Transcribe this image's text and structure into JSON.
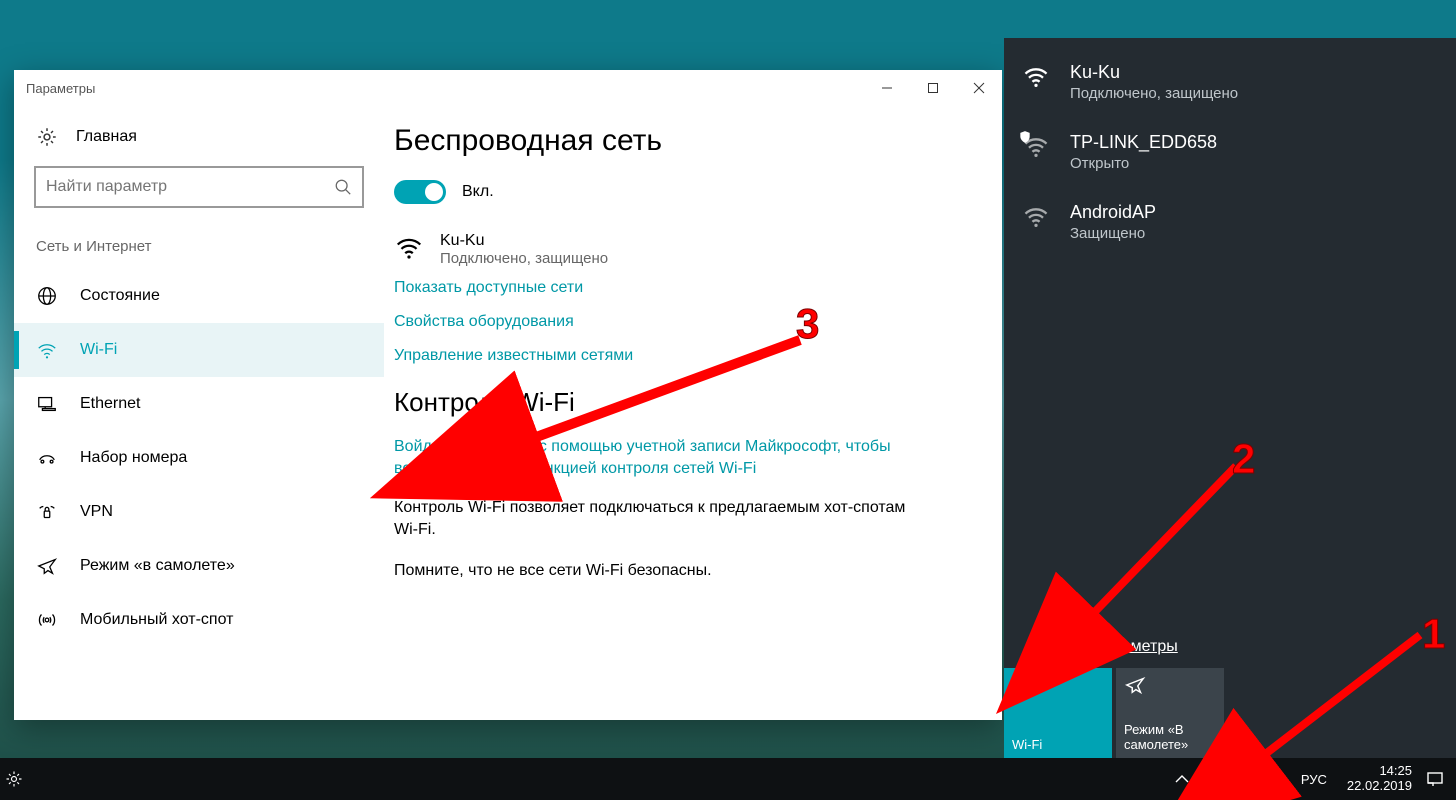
{
  "settings": {
    "window_title": "Параметры",
    "home_label": "Главная",
    "search_placeholder": "Найти параметр",
    "section_caption": "Сеть и Интернет",
    "nav": [
      {
        "label": "Состояние"
      },
      {
        "label": "Wi-Fi"
      },
      {
        "label": "Ethernet"
      },
      {
        "label": "Набор номера"
      },
      {
        "label": "VPN"
      },
      {
        "label": "Режим «в самолете»"
      },
      {
        "label": "Мобильный хот-спот"
      }
    ],
    "content": {
      "h1": "Беспроводная сеть",
      "toggle_label": "Вкл.",
      "current_net_name": "Ku-Ku",
      "current_net_status": "Подключено, защищено",
      "link_available": "Показать доступные сети",
      "link_hw": "Свойства оборудования",
      "link_known": "Управление известными сетями",
      "h2": "Контроль Wi-Fi",
      "signin_link": "Войдите в систему с помощью учетной записи Майкрософт, чтобы воспользоваться функцией контроля сетей Wi-Fi",
      "para1": "Контроль Wi-Fi позволяет подключаться к предлагаемым хот-спотам Wi-Fi.",
      "para2": "Помните, что не все сети Wi-Fi безопасны."
    }
  },
  "flyout": {
    "networks": [
      {
        "name": "Ku-Ku",
        "status": "Подключено, защищено",
        "secured": true
      },
      {
        "name": "TP-LINK_EDD658",
        "status": "Открыто",
        "secured": false,
        "shield": true
      },
      {
        "name": "AndroidAP",
        "status": "Защищено",
        "secured": true
      }
    ],
    "settings_link": "Сетевые параметры",
    "tile_wifi": "Wi-Fi",
    "tile_airplane": "Режим «В самолете»"
  },
  "taskbar": {
    "lang": "РУС",
    "time": "14:25",
    "date": "22.02.2019"
  },
  "annotations": {
    "n1": "1",
    "n2": "2",
    "n3": "3"
  }
}
